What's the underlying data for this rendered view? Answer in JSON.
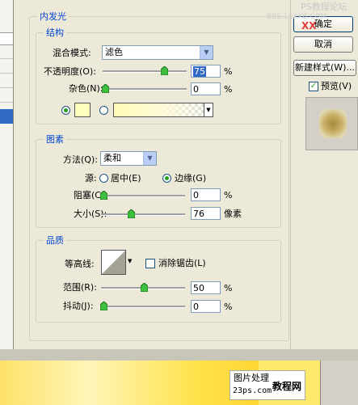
{
  "dialog": {
    "section_title": "内发光",
    "structure": {
      "title": "结构",
      "blend_mode_label": "混合模式:",
      "blend_mode_value": "滤色",
      "opacity_label": "不透明度(O):",
      "opacity_value": "75",
      "opacity_unit": "%",
      "noise_label": "杂色(N):",
      "noise_value": "0",
      "noise_unit": "%",
      "color_swatch": "#ffffc0",
      "gradient_start": "#fffbb8"
    },
    "elements": {
      "title": "图素",
      "method_label": "方法(Q):",
      "method_value": "柔和",
      "source_label": "源:",
      "source_center": "居中(E)",
      "source_edge": "边缘(G)",
      "source_selected": "边缘(G)",
      "choke_label": "阻塞(C):",
      "choke_value": "0",
      "choke_unit": "%",
      "size_label": "大小(S):",
      "size_value": "76",
      "size_unit": "像素"
    },
    "quality": {
      "title": "品质",
      "contour_label": "等高线:",
      "antialias_label": "消除锯齿(L)",
      "antialias_checked": false,
      "range_label": "范围(R):",
      "range_value": "50",
      "range_unit": "%",
      "jitter_label": "抖动(J):",
      "jitter_value": "0",
      "jitter_unit": "%"
    }
  },
  "buttons": {
    "ok": "确定",
    "cancel": "取消",
    "new_style": "新建样式(W)...",
    "preview": "预览(V)",
    "preview_checked": true
  },
  "watermark": {
    "top_right": "PS教程论坛",
    "top_right_sub": "BBS.16XX8.COM",
    "xx": "XX",
    "stamp_line1": "图片处理",
    "stamp_line2": "23ps.com",
    "stamp_line3": "教程网"
  },
  "colors": {
    "accent": "#0046d5",
    "selection": "#316ac5",
    "glow": "#ffd12a"
  }
}
